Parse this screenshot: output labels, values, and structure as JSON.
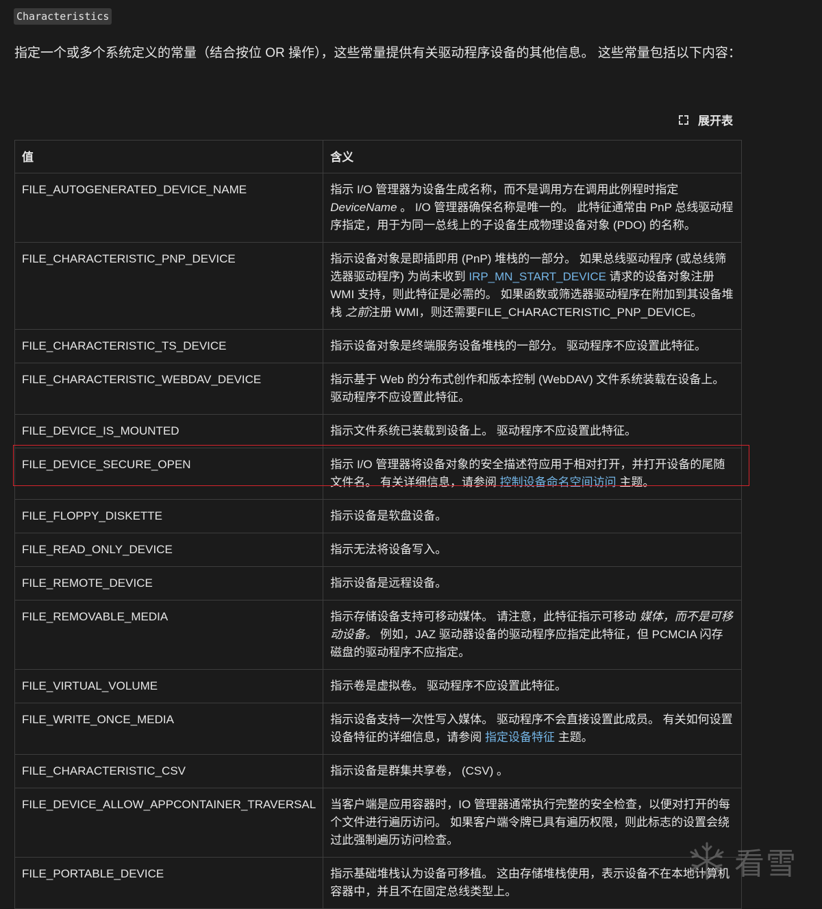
{
  "header": {
    "badge": "Characteristics",
    "intro": "指定一个或多个系统定义的常量（结合按位 OR 操作），这些常量提供有关驱动程序设备的其他信息。 这些常量包括以下内容："
  },
  "expand": {
    "label": "展开表",
    "icon": "expand-corners-icon"
  },
  "table": {
    "headers": [
      "值",
      "含义"
    ],
    "rows": [
      {
        "name": "FILE_AUTOGENERATED_DEVICE_NAME",
        "parts": [
          {
            "t": "指示 I/O 管理器为设备生成名称，而不是调用方在调用此例程时指定 "
          },
          {
            "t": "DeviceName",
            "em": true
          },
          {
            "t": " 。 I/O 管理器确保名称是唯一的。 此特征通常由 PnP 总线驱动程序指定，用于为同一总线上的子设备生成物理设备对象 (PDO) 的名称。"
          }
        ]
      },
      {
        "name": "FILE_CHARACTERISTIC_PNP_DEVICE",
        "parts": [
          {
            "t": "指示设备对象是即插即用 (PnP) 堆栈的一部分。 如果总线驱动程序 (或总线筛选器驱动程序) 为尚未收到 "
          },
          {
            "t": "IRP_MN_START_DEVICE",
            "link": true
          },
          {
            "t": " 请求的设备对象注册 WMI 支持，则此特征是必需的。 如果函数或筛选器驱动程序在附加到其设备堆栈 "
          },
          {
            "t": "之前",
            "em": true
          },
          {
            "t": "注册 WMI，则还需要FILE_CHARACTERISTIC_PNP_DEVICE。"
          }
        ]
      },
      {
        "name": "FILE_CHARACTERISTIC_TS_DEVICE",
        "parts": [
          {
            "t": "指示设备对象是终端服务设备堆栈的一部分。 驱动程序不应设置此特征。"
          }
        ]
      },
      {
        "name": "FILE_CHARACTERISTIC_WEBDAV_DEVICE",
        "parts": [
          {
            "t": "指示基于 Web 的分布式创作和版本控制 (WebDAV) 文件系统装载在设备上。 驱动程序不应设置此特征。"
          }
        ]
      },
      {
        "name": "FILE_DEVICE_IS_MOUNTED",
        "parts": [
          {
            "t": "指示文件系统已装载到设备上。 驱动程序不应设置此特征。"
          }
        ]
      },
      {
        "name": "FILE_DEVICE_SECURE_OPEN",
        "parts": [
          {
            "t": "指示 I/O 管理器将设备对象的安全描述符应用于相对打开，并打开设备的尾随文件名。 有关详细信息，请参阅 "
          },
          {
            "t": "控制设备命名空间访问",
            "link": true
          },
          {
            "t": " 主题。"
          }
        ]
      },
      {
        "name": "FILE_FLOPPY_DISKETTE",
        "parts": [
          {
            "t": "指示设备是软盘设备。"
          }
        ]
      },
      {
        "name": "FILE_READ_ONLY_DEVICE",
        "parts": [
          {
            "t": "指示无法将设备写入。"
          }
        ]
      },
      {
        "name": "FILE_REMOTE_DEVICE",
        "parts": [
          {
            "t": "指示设备是远程设备。"
          }
        ]
      },
      {
        "name": "FILE_REMOVABLE_MEDIA",
        "parts": [
          {
            "t": "指示存储设备支持可移动媒体。 请注意，此特征指示可移动 "
          },
          {
            "t": "媒体，而不是可移动设备。",
            "em": true
          },
          {
            "t": " 例如，JAZ 驱动器设备的驱动程序应指定此特征，但 PCMCIA 闪存磁盘的驱动程序不应指定。"
          }
        ]
      },
      {
        "name": "FILE_VIRTUAL_VOLUME",
        "parts": [
          {
            "t": "指示卷是虚拟卷。 驱动程序不应设置此特征。"
          }
        ]
      },
      {
        "name": "FILE_WRITE_ONCE_MEDIA",
        "parts": [
          {
            "t": "指示设备支持一次性写入媒体。 驱动程序不会直接设置此成员。 有关如何设置设备特征的详细信息，请参阅 "
          },
          {
            "t": "指定设备特征",
            "link": true
          },
          {
            "t": " 主题。"
          }
        ]
      },
      {
        "name": "FILE_CHARACTERISTIC_CSV",
        "parts": [
          {
            "t": "指示设备是群集共享卷， (CSV) 。"
          }
        ]
      },
      {
        "name": "FILE_DEVICE_ALLOW_APPCONTAINER_TRAVERSAL",
        "parts": [
          {
            "t": "当客户端是应用容器时，IO 管理器通常执行完整的安全检查，以便对打开的每个文件进行遍历访问。 如果客户端令牌已具有遍历权限，则此标志的设置会绕过此强制遍历访问检查。"
          }
        ]
      },
      {
        "name": "FILE_PORTABLE_DEVICE",
        "parts": [
          {
            "t": "指示基础堆栈认为设备可移植。 这由存储堆栈使用，表示设备不在本地计算机容器中，并且不在固定总线类型上。"
          }
        ]
      }
    ]
  },
  "watermark": {
    "text": "看雪",
    "icon": "snowflake-logo-icon"
  }
}
